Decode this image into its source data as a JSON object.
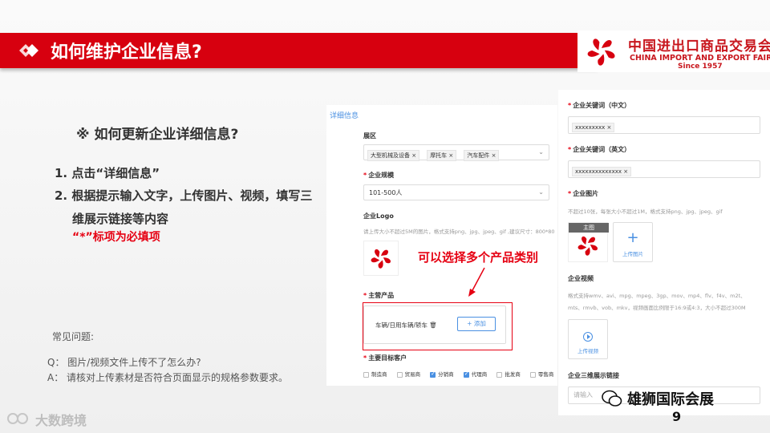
{
  "title": "如何维护企业信息?",
  "brand": {
    "cn": "中国进出口商品交易会",
    "en": "CHINA IMPORT AND EXPORT FAIR",
    "since": "Since 1957",
    "red": "#d7000f"
  },
  "content": {
    "subheading": "※ 如何更新企业详细信息?",
    "step1": "1. 点击“详细信息”",
    "step2_line1": "2. 根据提示输入文字，上传图片、视频，填写三",
    "step2_line2": "维展示链接等内容",
    "required_note": "“*”标项为必填项"
  },
  "faq": {
    "title": "常见问题:",
    "q": "Q： 图片/视频文件上传不了怎么办?",
    "a": "A： 请核对上传素材是否符合页面显示的规格参数要求。"
  },
  "form": {
    "tab": "详细信息",
    "exhibit_label": "展区",
    "exhibit_tags": [
      "大型机械及设备 ×",
      "摩托车 ×",
      "汽车配件 ×"
    ],
    "scale_label": "企业规模",
    "scale_value": "101-500人",
    "logo_label": "企业Logo",
    "logo_hint": "请上传大小不超过5M的图片，格式支持png、jpg、jpeg、gif ,建议尺寸：800*80",
    "callout": "可以选择多个产品类别",
    "product_label": "主营产品",
    "product_value": "车辆/日用车辆/轿车 🗑",
    "add_label": "+ 添加",
    "customer_label": "主要目标客户",
    "customers": [
      {
        "label": "制造商",
        "checked": false
      },
      {
        "label": "贸易商",
        "checked": false
      },
      {
        "label": "分销商",
        "checked": true
      },
      {
        "label": "代理商",
        "checked": true
      },
      {
        "label": "批发商",
        "checked": false
      },
      {
        "label": "零售商",
        "checked": false
      }
    ]
  },
  "right_panel": {
    "kw_cn_label": "企业关键词（中文）",
    "kw_cn_tag": "xxxxxxxxx ×",
    "kw_en_label": "企业关键词（英文）",
    "kw_en_tag": "xxxxxxxxxxxxxx ×",
    "img_label": "企业图片",
    "img_hint": "不超过10张，每张大小不超过1M，格式支持png、jpg、jpeg、gif",
    "main_img_caption": "主图",
    "upload_img": "上传图片",
    "video_label": "企业视频",
    "video_hint1": "格式支持wmv、avi、mpg、mpeg、3gp、mov、mp4、flv、f4v、m2t、",
    "video_hint2": "mts、rmvb、vob、mkv，视频画面比例限于16:9或4:3，大小不超过300M",
    "upload_video": "上传视频",
    "link_label": "企业三维展示链接",
    "link_placeholder": "请输入"
  },
  "watermark_left": "大数跨境",
  "watermark_right": "雄狮国际会展",
  "page_number": "9"
}
